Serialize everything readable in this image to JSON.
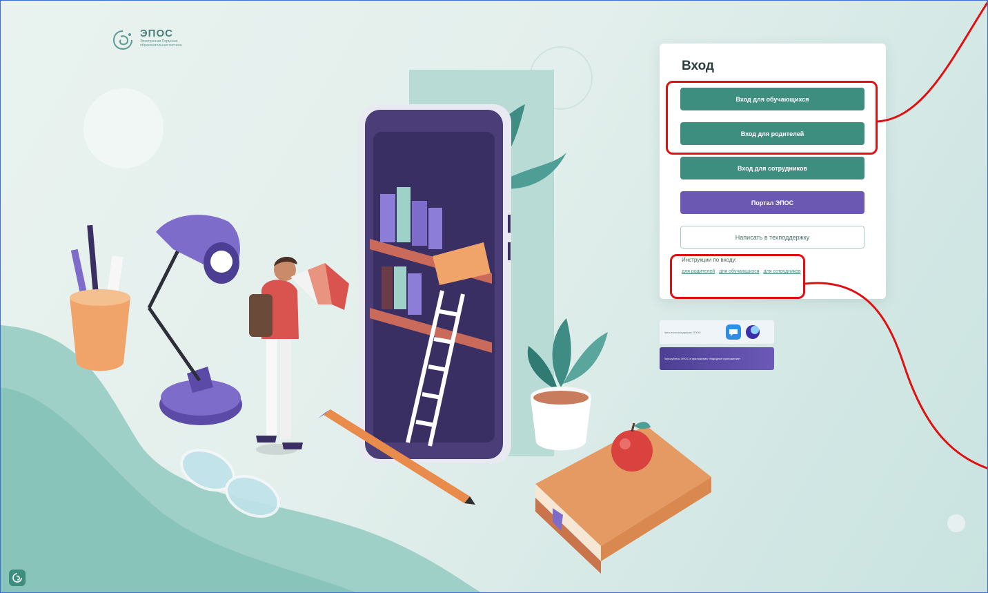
{
  "logo": {
    "title": "ЭПОС",
    "subtitle": "Электронная Пермская образовательная система"
  },
  "login": {
    "title": "Вход",
    "buttons": [
      {
        "label": "Вход для обучающихся",
        "style": "green"
      },
      {
        "label": "Вход для родителей",
        "style": "green"
      },
      {
        "label": "Вход для сотрудников",
        "style": "green"
      },
      {
        "label": "Портал ЭПОС",
        "style": "purple"
      },
      {
        "label": "Написать в техподдержку",
        "style": "outline"
      }
    ],
    "instructions": {
      "label": "Инструкции по входу:",
      "links": [
        "для родителей",
        "для обучающихся",
        "для сотрудников"
      ]
    }
  },
  "banners": {
    "top": "Чаты в мессенджерах ЭПОС",
    "bottom": "Пользуйтесь ЭПОС в приложении «Народное приложение»"
  },
  "colors": {
    "primary_green": "#3e8e7f",
    "portal_purple": "#6a58b3",
    "annotation_red": "#e01010"
  }
}
